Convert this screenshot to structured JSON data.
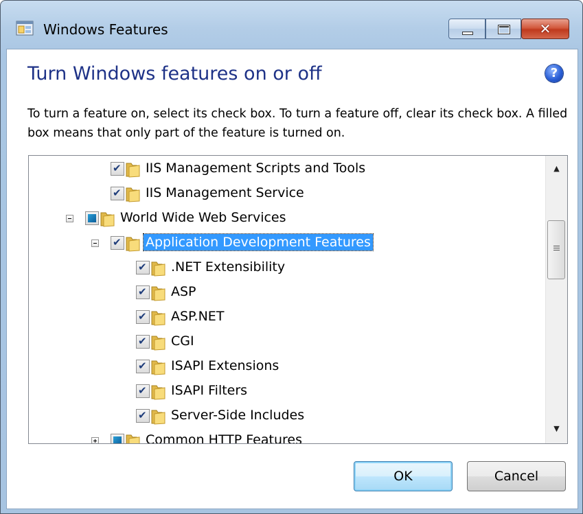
{
  "window": {
    "title": "Windows Features",
    "close_glyph": "✕"
  },
  "dialog": {
    "heading": "Turn Windows features on or off",
    "help_glyph": "?",
    "instructions": "To turn a feature on, select its check box. To turn a feature off, clear its check box. A filled box means that only part of the feature is turned on."
  },
  "tree": {
    "items": [
      {
        "label": "IIS Management Scripts and Tools",
        "state": "checked"
      },
      {
        "label": "IIS Management Service",
        "state": "checked"
      },
      {
        "label": "World Wide Web Services",
        "state": "partial",
        "expander": "collapse"
      },
      {
        "label": "Application Development Features",
        "state": "checked",
        "expander": "collapse",
        "selected": true
      },
      {
        "label": ".NET Extensibility",
        "state": "checked"
      },
      {
        "label": "ASP",
        "state": "checked"
      },
      {
        "label": "ASP.NET",
        "state": "checked"
      },
      {
        "label": "CGI",
        "state": "checked"
      },
      {
        "label": "ISAPI Extensions",
        "state": "checked"
      },
      {
        "label": "ISAPI Filters",
        "state": "checked"
      },
      {
        "label": "Server-Side Includes",
        "state": "checked"
      },
      {
        "label": "Common HTTP Features",
        "state": "partial",
        "expander": "expand"
      }
    ],
    "scroll_up_glyph": "▲",
    "scroll_down_glyph": "▼"
  },
  "buttons": {
    "ok_label": "OK",
    "cancel_label": "Cancel"
  },
  "colors": {
    "heading": "#1e3287",
    "selection": "#3399ff"
  }
}
